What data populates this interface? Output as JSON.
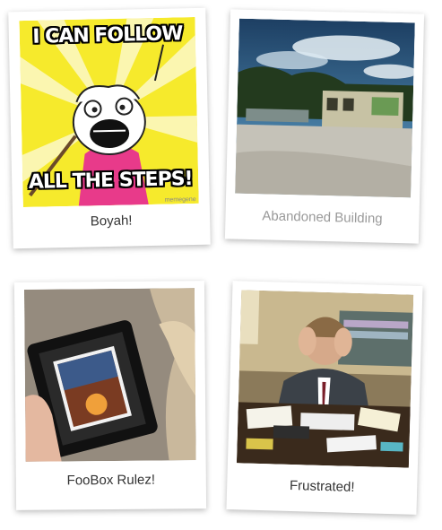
{
  "gallery": {
    "items": [
      {
        "caption": "Boyah!",
        "meme_top_text": "I CAN FOLLOW",
        "meme_bottom_text": "ALL THE STEPS!",
        "watermark": "memegene"
      },
      {
        "caption": "Abandoned Building"
      },
      {
        "caption": "FooBox Rulez!"
      },
      {
        "caption": "Frustrated!"
      }
    ]
  },
  "colors": {
    "meme_yellow": "#f6ea2c",
    "meme_pink": "#e83a8a",
    "caption_text": "#333333",
    "caption_faded": "#999999"
  }
}
